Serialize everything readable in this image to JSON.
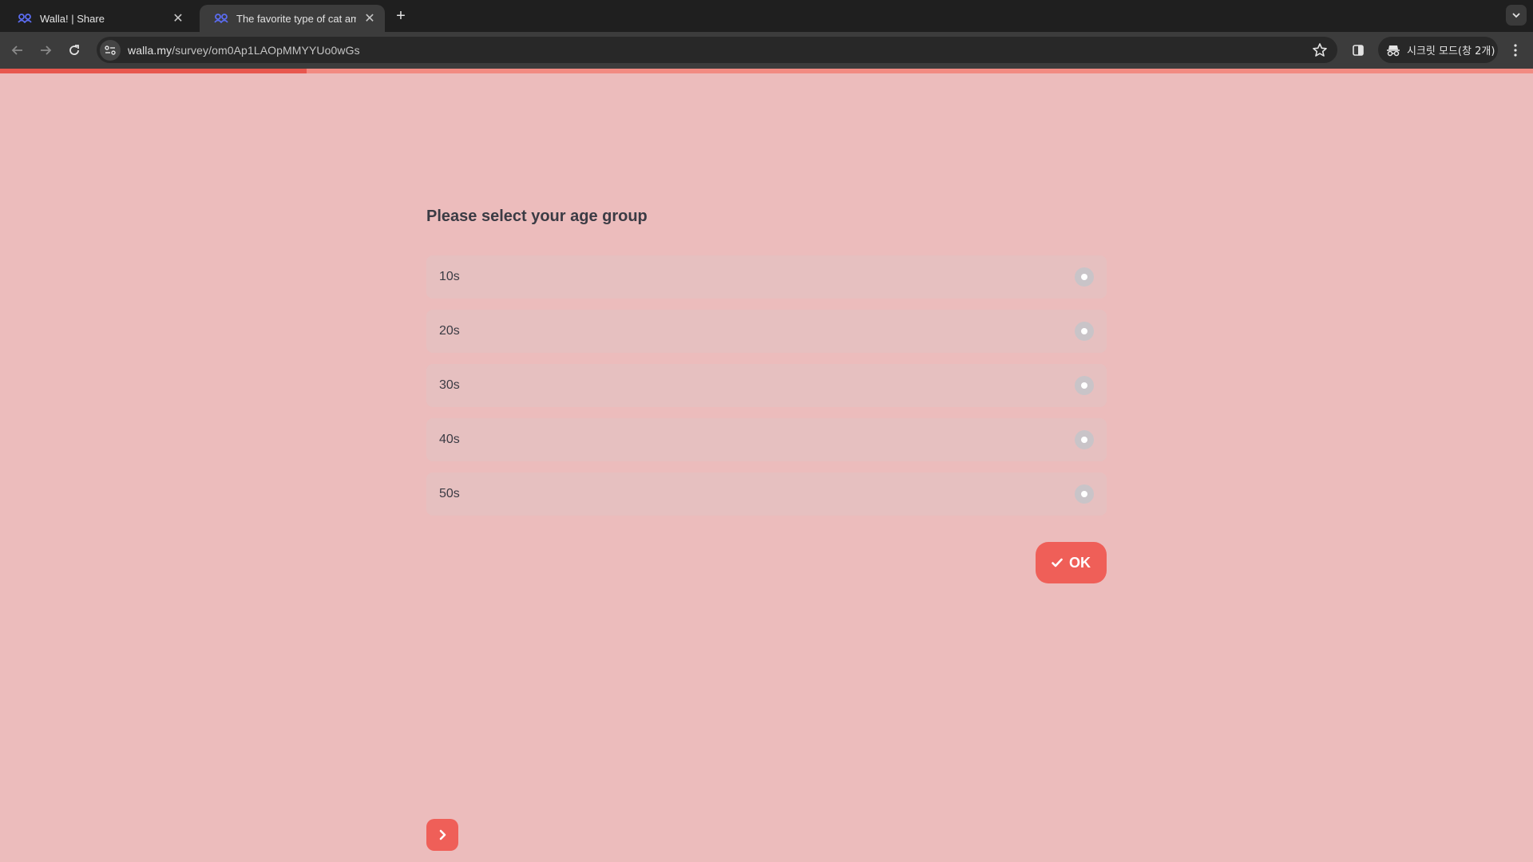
{
  "browser": {
    "tabs": [
      {
        "title": "Walla! | Share",
        "active": false
      },
      {
        "title": "The favorite type of cat amon",
        "active": true
      }
    ],
    "url": {
      "domain": "walla.my",
      "path": "/survey/om0Ap1LAOpMMYYUo0wGs"
    },
    "incognito_label": "시크릿 모드(창 2개)"
  },
  "survey": {
    "progress_fraction": 0.2,
    "question": "Please select your age group",
    "options": [
      {
        "label": "10s"
      },
      {
        "label": "20s"
      },
      {
        "label": "30s"
      },
      {
        "label": "40s"
      },
      {
        "label": "50s"
      }
    ],
    "ok_label": "OK"
  },
  "colors": {
    "page_background": "#ecbcbc",
    "accent": "#ef5f58",
    "progress_fill": "#e8574e",
    "progress_track": "#f28b82"
  },
  "icons": {
    "favicon": "walla-logo-icon",
    "ok": "check-icon",
    "next": "chevron-right-icon"
  }
}
